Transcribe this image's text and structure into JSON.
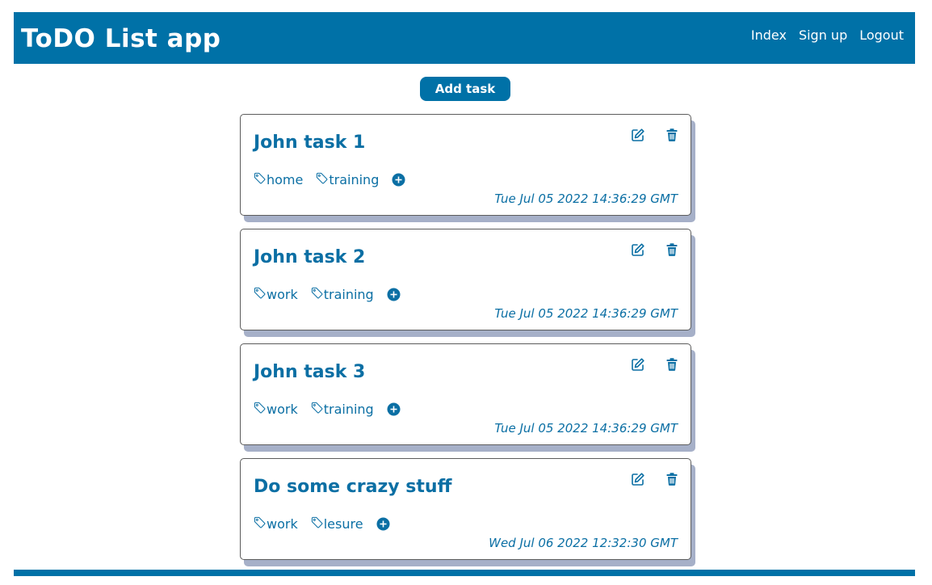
{
  "header": {
    "title": "ToDO List app",
    "nav": [
      "Index",
      "Sign up",
      "Logout"
    ]
  },
  "add_task_label": "Add task",
  "tasks": [
    {
      "title": "John task 1",
      "tags": [
        "home",
        "training"
      ],
      "date": "Tue Jul 05 2022 14:36:29 GMT"
    },
    {
      "title": "John task 2",
      "tags": [
        "work",
        "training"
      ],
      "date": "Tue Jul 05 2022 14:36:29 GMT"
    },
    {
      "title": "John task 3",
      "tags": [
        "work",
        "training"
      ],
      "date": "Tue Jul 05 2022 14:36:29 GMT"
    },
    {
      "title": "Do some crazy stuff",
      "tags": [
        "work",
        "lesure"
      ],
      "date": "Wed Jul 06 2022 12:32:30 GMT"
    }
  ],
  "icons": {
    "edit": "edit-icon",
    "delete": "trash-icon",
    "tag": "tag-icon",
    "add_tag": "plus-circle-icon"
  },
  "colors": {
    "primary": "#0071a7",
    "text_accent": "#0b6fa4",
    "card_shadow": "#a6b0c8"
  }
}
